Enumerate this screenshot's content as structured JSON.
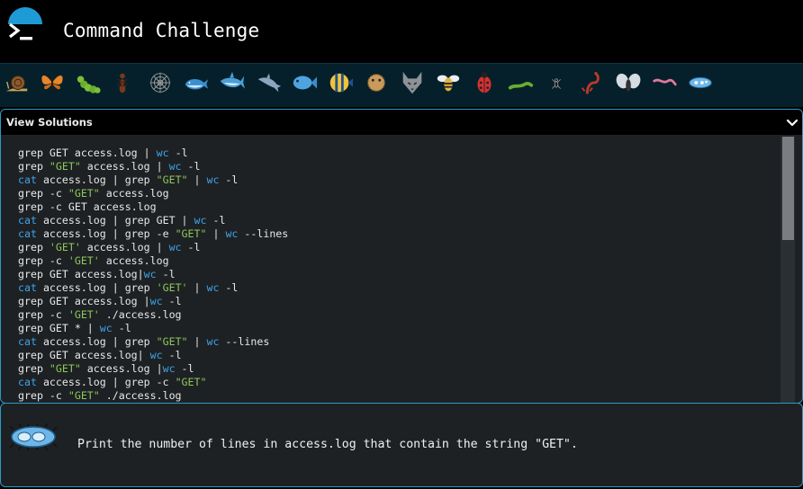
{
  "app": {
    "title": "Command Challenge",
    "logo_icon": "terminal-prompt-icon",
    "accent_color": "#1e9bd7"
  },
  "iconbar": {
    "items": [
      {
        "icon": "snail-icon"
      },
      {
        "icon": "butterfly-icon"
      },
      {
        "icon": "caterpillar-icon"
      },
      {
        "icon": "ant-icon"
      },
      {
        "icon": "spider-web-icon"
      },
      {
        "icon": "whale-icon"
      },
      {
        "icon": "shark-icon"
      },
      {
        "icon": "dolphin-icon"
      },
      {
        "icon": "fish-icon"
      },
      {
        "icon": "tropical-fish-icon"
      },
      {
        "icon": "pufferfish-icon"
      },
      {
        "icon": "wolf-icon"
      },
      {
        "icon": "bee-icon"
      },
      {
        "icon": "ladybug-icon"
      },
      {
        "icon": "worm-icon"
      },
      {
        "icon": "spider-icon"
      },
      {
        "icon": "scorpion-icon"
      },
      {
        "icon": "fly-icon"
      },
      {
        "icon": "worm-pink-icon"
      },
      {
        "icon": "microbe-icon"
      }
    ]
  },
  "solutions_panel": {
    "label": "View Solutions",
    "toggle_icon": "chevron-down-icon",
    "lines": [
      {
        "text": "grep GET access.log | wc -l"
      },
      {
        "text": "grep \"GET\" access.log | wc -l"
      },
      {
        "text": "cat access.log | grep \"GET\" | wc -l"
      },
      {
        "text": "grep -c \"GET\" access.log"
      },
      {
        "text": "grep -c GET access.log"
      },
      {
        "text": "cat access.log | grep GET | wc -l"
      },
      {
        "text": "cat access.log | grep -e \"GET\" | wc --lines"
      },
      {
        "text": "grep 'GET' access.log | wc -l"
      },
      {
        "text": "grep -c 'GET' access.log"
      },
      {
        "text": "grep GET access.log|wc -l"
      },
      {
        "text": "cat access.log | grep 'GET' | wc -l"
      },
      {
        "text": "grep GET access.log |wc -l"
      },
      {
        "text": "grep -c 'GET' ./access.log"
      },
      {
        "text": "grep GET * | wc -l"
      },
      {
        "text": "cat access.log | grep \"GET\" | wc --lines"
      },
      {
        "text": "grep GET access.log| wc -l"
      },
      {
        "text": "grep \"GET\" access.log |wc -l"
      },
      {
        "text": "cat access.log | grep -c \"GET\""
      },
      {
        "text": "grep -c \"GET\" ./access.log"
      }
    ],
    "colors": {
      "command": "#3fa3e8",
      "string": "#8fc65a"
    }
  },
  "challenge": {
    "icon": "microbe-icon",
    "prompt": "Print the number of lines in access.log that contain the string \"GET\"."
  }
}
